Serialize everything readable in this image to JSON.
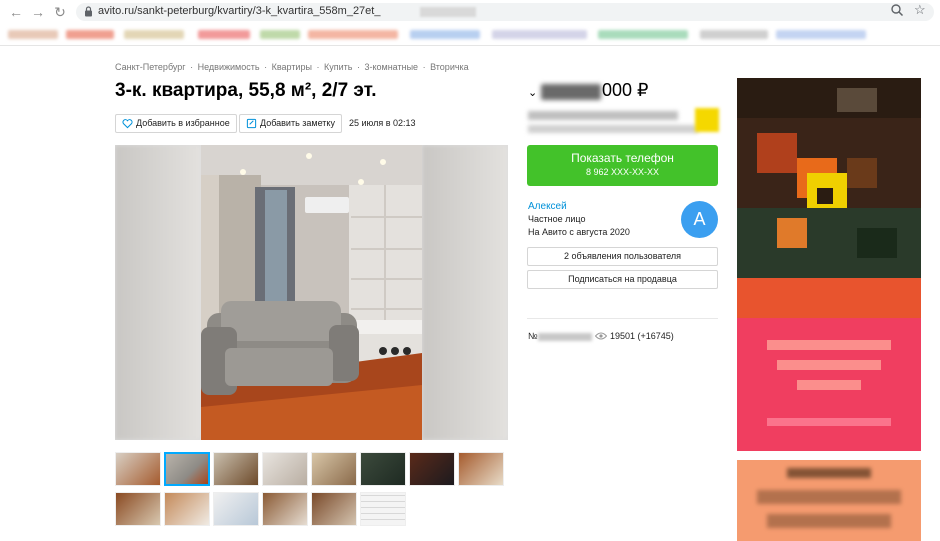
{
  "browser": {
    "url": "avito.ru/sankt-peterburg/kvartiry/3-k_kvartira_558m_27et_"
  },
  "breadcrumbs": [
    "Санкт-Петербург",
    "Недвижимость",
    "Квартиры",
    "Купить",
    "3-комнатные",
    "Вторичка"
  ],
  "breadcrumb_separator": "·",
  "listing": {
    "title": "3-к. квартира, 55,8 м², 2/7 эт.",
    "add_favorite_label": "Добавить в избранное",
    "add_note_label": "Добавить заметку",
    "date": "25 июля в 02:13"
  },
  "price": {
    "caret": "⌄",
    "visible_part": "000 ₽"
  },
  "contact": {
    "show_phone_label": "Показать телефон",
    "phone_masked": "8 962 XXX-XX-XX"
  },
  "seller": {
    "name": "Алексей",
    "type": "Частное лицо",
    "since": "На Авито с августа 2020",
    "avatar_letter": "А",
    "listings_button": "2 объявления пользователя",
    "subscribe_button": "Подписаться на продавца"
  },
  "stats": {
    "ad_number_prefix": "№",
    "views": "19501 (+16745)"
  },
  "colors": {
    "accent_green": "#43c22a",
    "link_blue": "#0091d9",
    "avatar_blue": "#3b9ff0",
    "thumb_active": "#00aaff"
  }
}
